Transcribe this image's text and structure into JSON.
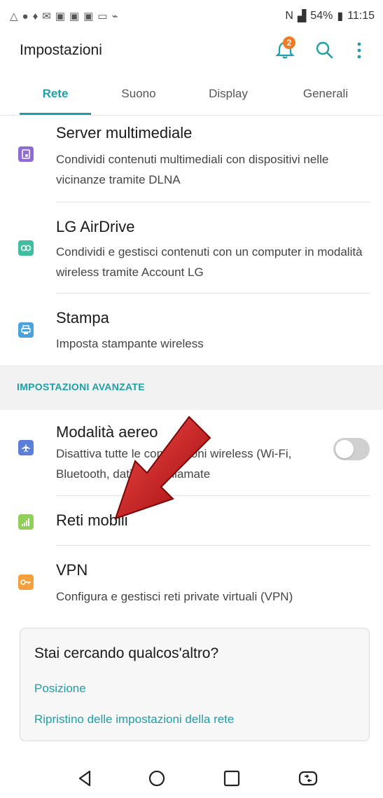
{
  "status_bar": {
    "battery": "54%",
    "time": "11:15"
  },
  "app_bar": {
    "title": "Impostazioni",
    "notification_count": "2"
  },
  "tabs": [
    {
      "label": "Rete",
      "active": true
    },
    {
      "label": "Suono",
      "active": false
    },
    {
      "label": "Display",
      "active": false
    },
    {
      "label": "Generali",
      "active": false
    }
  ],
  "settings": [
    {
      "title": "Server multimediale",
      "desc": "Condividi contenuti multimediali con dispositivi nelle vicinanze tramite DLNA",
      "icon": "media-server-icon",
      "color": "#8e6bd6"
    },
    {
      "title": "LG AirDrive",
      "desc": "Condividi e gestisci contenuti con un computer in modalità wireless tramite Account LG",
      "icon": "airdrive-icon",
      "color": "#3fbf9f"
    },
    {
      "title": "Stampa",
      "desc": "Imposta stampante wireless",
      "icon": "printer-icon",
      "color": "#4aa3df"
    }
  ],
  "section_header": "IMPOSTAZIONI AVANZATE",
  "advanced": [
    {
      "title": "Modalità aereo",
      "desc": "Disattiva tutte le connessioni wireless (Wi-Fi, Bluetooth, dati) e le chiamate",
      "icon": "airplane-icon",
      "color": "#5b7fd8",
      "toggle": "off"
    },
    {
      "title": "Reti mobili",
      "icon": "signal-bars-icon",
      "color": "#8fcf5a"
    },
    {
      "title": "VPN",
      "desc": "Configura e gestisci reti private virtuali (VPN)",
      "icon": "key-icon",
      "color": "#f5a03c"
    }
  ],
  "suggestion_card": {
    "title": "Stai cercando qualcos'altro?",
    "links": [
      "Posizione",
      "Ripristino delle impostazioni della rete"
    ]
  },
  "colors": {
    "accent": "#1e9fa8",
    "badge": "#f07b24",
    "arrow": "#d41414"
  }
}
